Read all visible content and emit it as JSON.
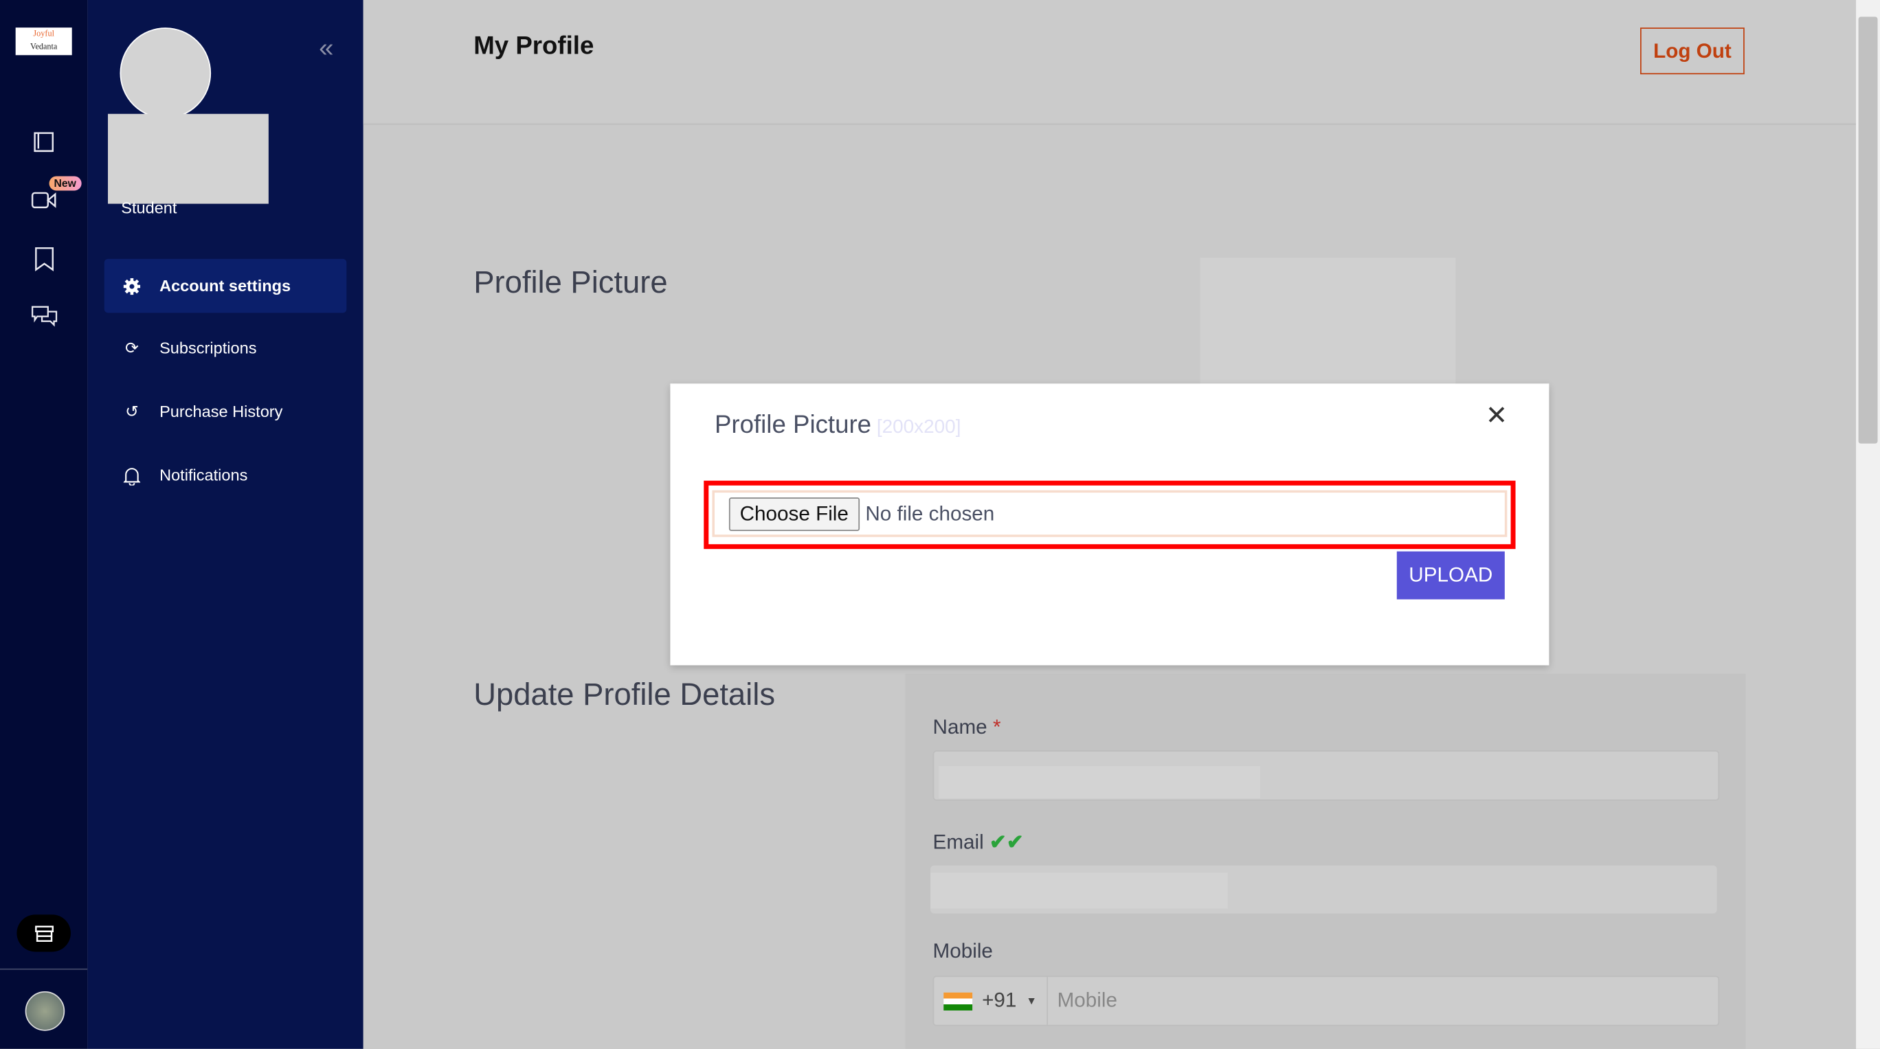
{
  "brand": {
    "logo_text": "Joyful Vedanta"
  },
  "rail": {
    "new_badge": "New",
    "items": [
      "book-icon",
      "video-icon",
      "bookmark-icon",
      "chat-icon"
    ]
  },
  "sidebar": {
    "role": "Student",
    "items": [
      {
        "label": "Account settings",
        "icon": "gear-icon",
        "active": true
      },
      {
        "label": "Subscriptions",
        "icon": "refresh-icon"
      },
      {
        "label": "Purchase History",
        "icon": "history-icon"
      },
      {
        "label": "Notifications",
        "icon": "bell-icon"
      }
    ]
  },
  "header": {
    "title": "My Profile",
    "logout": "Log Out"
  },
  "sections": {
    "profile_picture": "Profile Picture",
    "update_details": "Update Profile Details"
  },
  "modal": {
    "title": "Profile Picture",
    "hint": "[200x200]",
    "choose_file": "Choose File",
    "no_file": "No file chosen",
    "upload": "UPLOAD"
  },
  "form": {
    "name_label": "Name",
    "required": "*",
    "email_label": "Email",
    "mobile_label": "Mobile",
    "country_code": "+91",
    "mobile_placeholder": "Mobile"
  },
  "colors": {
    "accent": "#5853d8",
    "logout": "#c0400f",
    "highlight": "#ff0000",
    "sidebar": "#06134c"
  }
}
